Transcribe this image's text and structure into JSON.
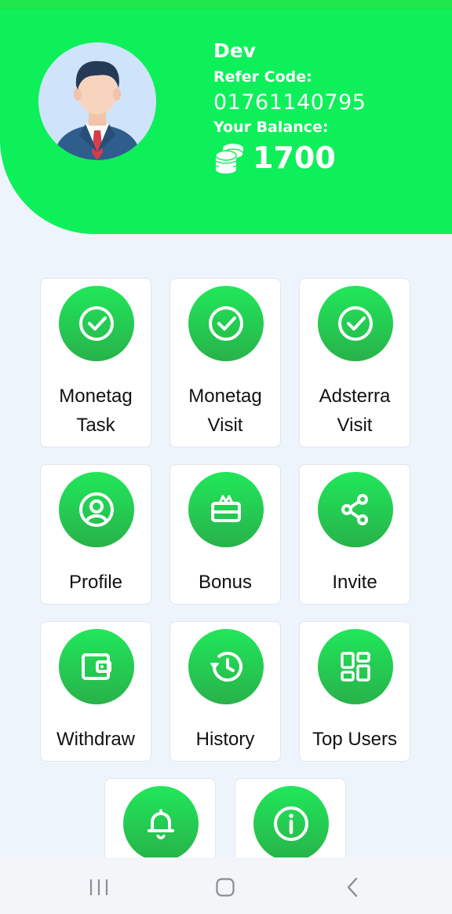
{
  "user": {
    "name": "Dev",
    "refer_label": "Refer Code:",
    "refer_code": "01761140795",
    "balance_label": "Your Balance:",
    "balance": "1700"
  },
  "menu": [
    {
      "label": "Monetag Task",
      "icon": "check-circle-icon"
    },
    {
      "label": "Monetag Visit",
      "icon": "check-circle-icon"
    },
    {
      "label": "Adsterra Visit",
      "icon": "check-circle-icon"
    },
    {
      "label": "Profile",
      "icon": "user-circle-icon"
    },
    {
      "label": "Bonus",
      "icon": "gift-icon"
    },
    {
      "label": "Invite",
      "icon": "share-icon"
    },
    {
      "label": "Withdraw",
      "icon": "wallet-icon"
    },
    {
      "label": "History",
      "icon": "history-icon"
    },
    {
      "label": "Top Users",
      "icon": "dashboard-icon"
    },
    {
      "label": "",
      "icon": "bell-icon"
    },
    {
      "label": "",
      "icon": "info-icon"
    }
  ],
  "colors": {
    "header": "#0ef05a",
    "accent": "#21e75a",
    "background": "#eef4fb"
  },
  "system_nav": [
    "recents-icon",
    "home-icon",
    "back-icon"
  ]
}
